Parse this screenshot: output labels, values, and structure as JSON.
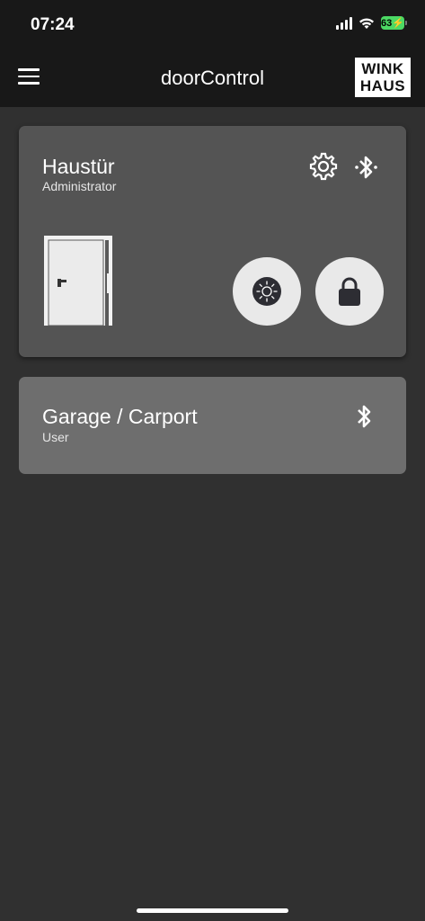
{
  "status_bar": {
    "time": "07:24",
    "battery": "63"
  },
  "header": {
    "title": "doorControl",
    "logo_line1": "WINK",
    "logo_line2": "HAUS"
  },
  "doors": [
    {
      "name": "Haustür",
      "role": "Administrator"
    },
    {
      "name": "Garage / Carport",
      "role": "User"
    }
  ],
  "colors": {
    "header": "#181818",
    "background": "#303030",
    "card_primary": "#545454",
    "card_secondary": "#6e6e6e",
    "battery": "#4cd964"
  },
  "icons": [
    "menu-icon",
    "gear-icon",
    "bluetooth-icon",
    "door-icon",
    "light-icon",
    "lock-icon"
  ]
}
